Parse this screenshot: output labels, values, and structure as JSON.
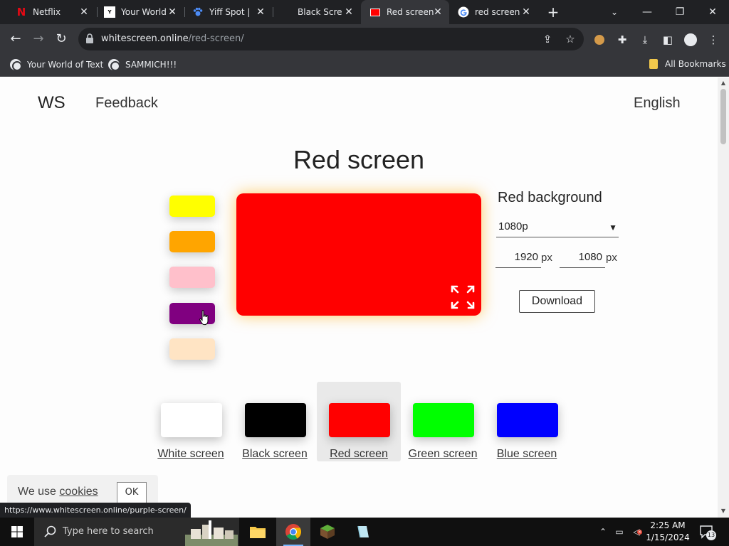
{
  "tabs": [
    {
      "title": "Netflix",
      "favicon": "netflix-icon"
    },
    {
      "title": "Your World",
      "favicon": "yourworld-icon"
    },
    {
      "title": "Yiff Spot |",
      "favicon": "paw-icon"
    },
    {
      "title": "Black Scre",
      "favicon": "blank-icon"
    },
    {
      "title": "Red screen",
      "favicon": "red-square-icon",
      "active": true
    },
    {
      "title": "red screen",
      "favicon": "google-icon"
    }
  ],
  "address": {
    "domain": "whitescreen.online",
    "path": "/red-screen/"
  },
  "bookmarks": [
    {
      "label": "Your World of Text"
    },
    {
      "label": "SAMMICH!!!"
    }
  ],
  "all_bookmarks_label": "All Bookmarks",
  "site": {
    "logo": "WS",
    "feedback": "Feedback",
    "language": "English"
  },
  "main": {
    "title": "Red screen",
    "color_swatches": [
      {
        "name": "yellow",
        "color": "#ffff00"
      },
      {
        "name": "orange",
        "color": "#ffa500"
      },
      {
        "name": "pink",
        "color": "#ffc0cb"
      },
      {
        "name": "purple",
        "color": "#800080"
      },
      {
        "name": "bisque",
        "color": "#ffe4c4"
      }
    ],
    "preview_color": "#ff0000",
    "side_heading": "Red background",
    "resolution": "1080p",
    "width": "1920",
    "height": "1080",
    "px_unit": "px",
    "download": "Download"
  },
  "screens": [
    {
      "label": "White screen",
      "color": "#ffffff"
    },
    {
      "label": "Black screen",
      "color": "#000000"
    },
    {
      "label": "Red screen",
      "color": "#ff0000",
      "selected": true
    },
    {
      "label": "Green screen",
      "color": "#00ff00"
    },
    {
      "label": "Blue screen",
      "color": "#0000ff"
    }
  ],
  "cookie": {
    "text": "We use",
    "link": "cookies",
    "ok": "OK"
  },
  "status_url": "https://www.whitescreen.online/purple-screen/",
  "taskbar": {
    "search_placeholder": "Type here to search",
    "time": "2:25 AM",
    "date": "1/15/2024",
    "notifications": "13"
  }
}
